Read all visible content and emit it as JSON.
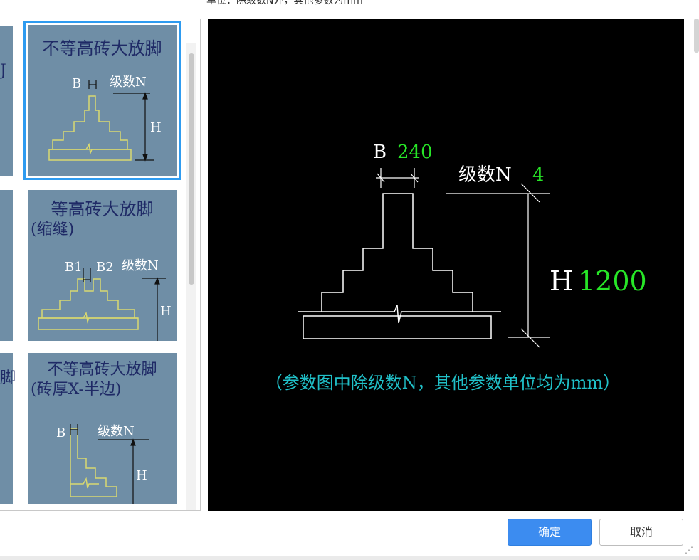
{
  "header": {
    "note": "单位：除级数N外，其他参数为mm"
  },
  "tiles": [
    {
      "title": "不等高砖大放脚",
      "label_b": "B",
      "label_n": "级数N",
      "label_h": "H",
      "selected": true
    },
    {
      "title": "等高砖大放脚",
      "title2": "(缩缝)",
      "label_b1": "B1",
      "label_b2": "B2",
      "label_n": "级数N",
      "label_h": "H"
    },
    {
      "title": "不等高砖大放脚",
      "title2": "(砖厚X-半边)",
      "label_b": "B",
      "label_n": "级数N",
      "label_h": "H"
    }
  ],
  "left_cut_glyphs": [
    "J",
    "",
    "脚"
  ],
  "preview": {
    "b_label": "B",
    "b_value": "240",
    "n_label": "级数N",
    "n_value": "4",
    "h_label": "H",
    "h_value": "1200",
    "note": "（参数图中除级数N，其他参数单位均为mm）"
  },
  "buttons": {
    "ok": "确定",
    "cancel": "取消"
  },
  "colors": {
    "accent": "#3c8cf0",
    "tile_bg": "#6f8ea6",
    "line_yellow": "#d8d870",
    "value_green": "#27e627",
    "note_cyan": "#20c0c8"
  }
}
